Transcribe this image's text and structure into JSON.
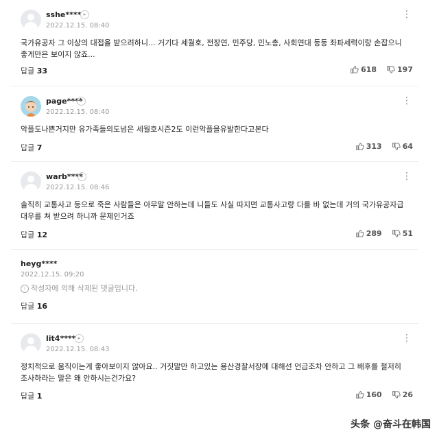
{
  "comments": [
    {
      "username": "sshe****",
      "date": "2022.12.15. 08:40",
      "text": "국가유공자 그 이상의 대접을 받으려하니... 거기다 세월호, 전장연, 민주당, 민노총, 사회연대 등등 좌파세력이랑 손잡으니 좋게만은 보이지 않죠...",
      "reply_label": "답글",
      "reply_count": "33",
      "likes": "618",
      "dislikes": "197"
    },
    {
      "username": "page****",
      "date": "2022.12.15. 08:40",
      "text": "악플도나쁜거지만 유가족들의도넘은 세월호시즌2도 이런악플을유발한다고본다",
      "reply_label": "답글",
      "reply_count": "7",
      "likes": "313",
      "dislikes": "64"
    },
    {
      "username": "warb****",
      "date": "2022.12.15. 08:46",
      "text": "솔직히 교통사고 등으로 죽은 사람들은 아무말 안하는데 니들도 사실 따지면 교통사고랑 다를 바 없는데 거의 국가유공자급 대우를 쳐 받으려 하니까 문제인거죠",
      "reply_label": "답글",
      "reply_count": "12",
      "likes": "289",
      "dislikes": "51"
    },
    {
      "username": "heyg****",
      "date": "2022.12.15. 09:20",
      "deleted_text": "작성자에 의해 삭제된 댓글입니다.",
      "reply_label": "답글",
      "reply_count": "16"
    },
    {
      "username": "lit4****",
      "date": "2022.12.15. 08:43",
      "text": "정치적으로 움직이는게 좋아보이지 않아요.. 거짓말만 하고있는 용산경찰서장에 대해선 언급조차 안하고 그 배후를 철저히 조사하라는 말은 왜 안하시는건가요?",
      "reply_label": "답글",
      "reply_count": "1",
      "likes": "160",
      "dislikes": "26"
    }
  ],
  "watermark": "头条 @奋斗在韩国"
}
